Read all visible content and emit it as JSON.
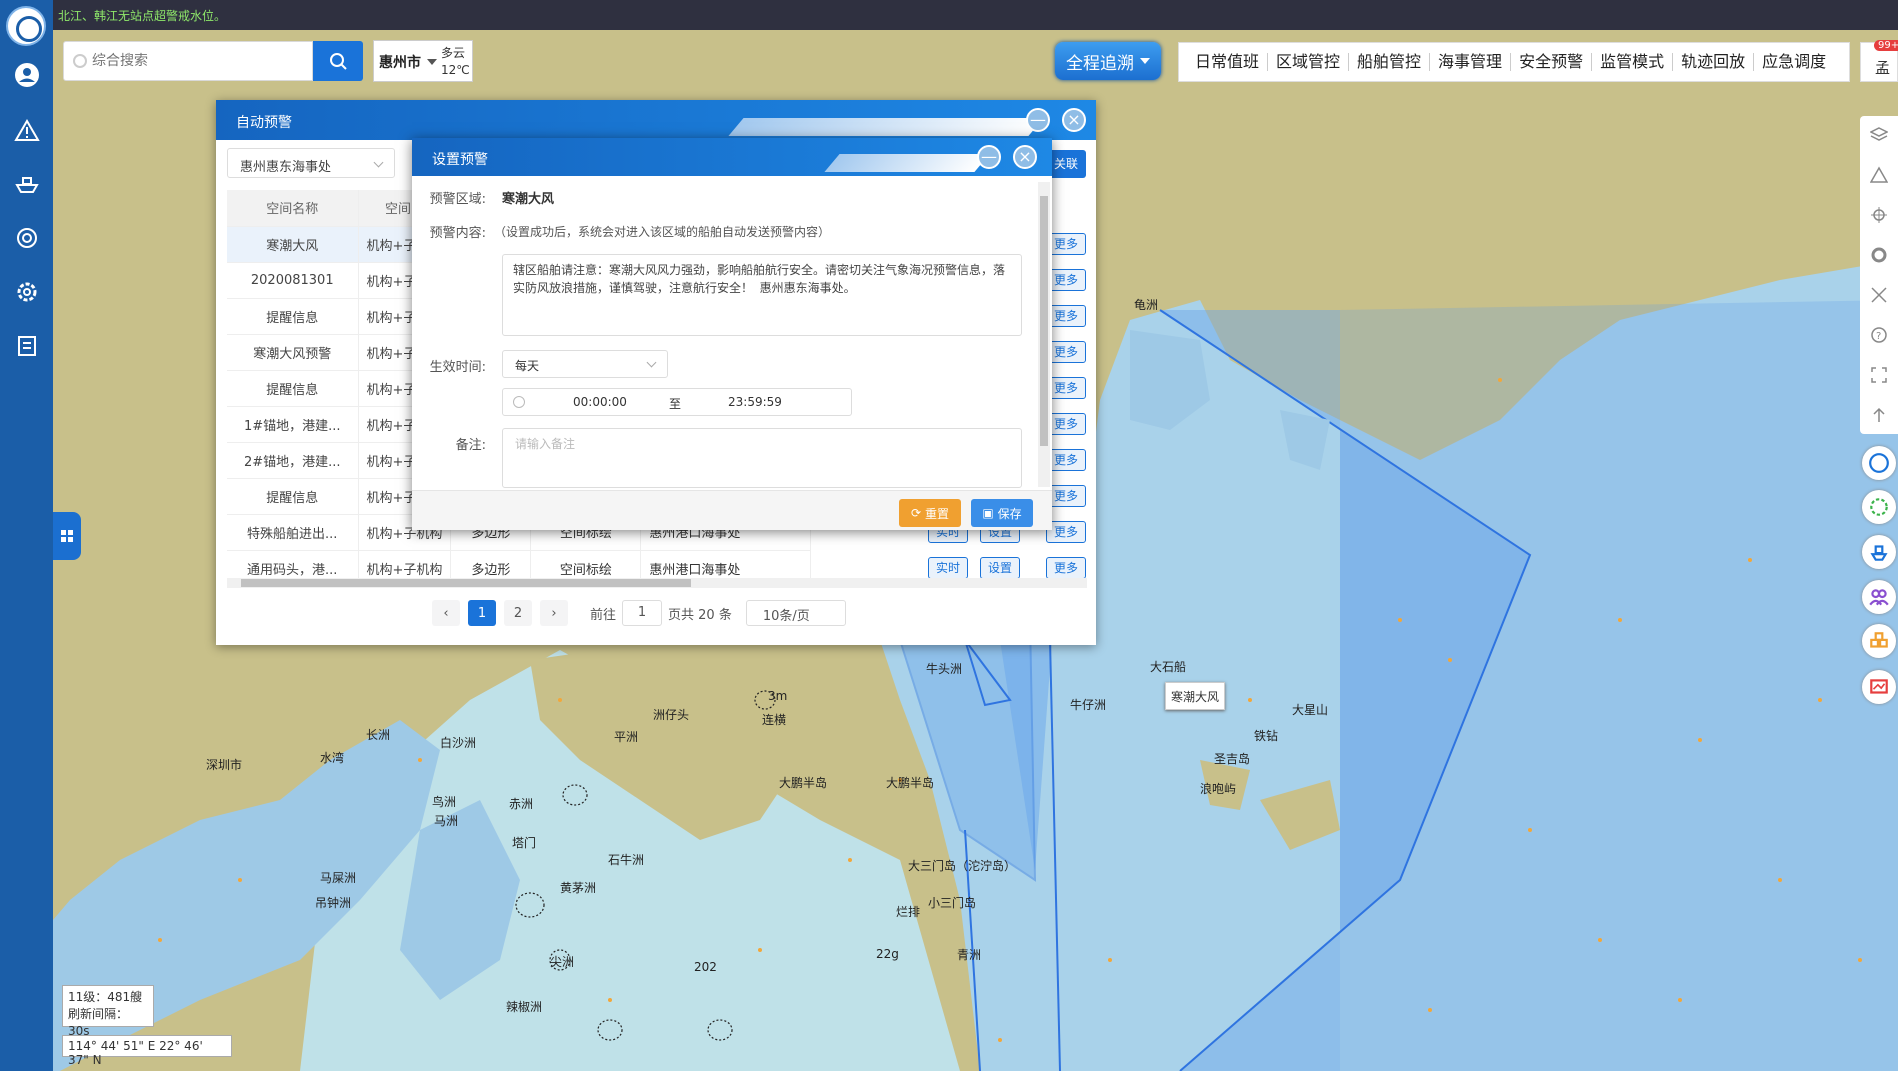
{
  "notice": "北江、韩江无站点超警戒水位。",
  "search": {
    "placeholder": "综合搜索"
  },
  "city": {
    "name": "惠州市",
    "weather": "多云",
    "temp": "12℃"
  },
  "track_button": "全程追溯",
  "top_menu": [
    "日常值班",
    "区域管控",
    "船舶管控",
    "海事管理",
    "安全预警",
    "监管模式",
    "轨迹回放",
    "应急调度"
  ],
  "top_right": {
    "badge": "99+",
    "label": "孟"
  },
  "sidebar_icons": [
    "user-icon",
    "alert-icon",
    "ship-icon",
    "lifebuoy-icon",
    "settings-icon",
    "clipboard-icon"
  ],
  "dialog_auto": {
    "title": "自动预警",
    "org_select": "惠州惠东海事处",
    "relate_button": "关联",
    "columns": [
      "空间名称",
      "空间归"
    ],
    "rows": [
      {
        "name": "寒潮大风",
        "type": "机构+子"
      },
      {
        "name": "2020081301",
        "type": "机构+子"
      },
      {
        "name": "提醒信息",
        "type": "机构+子"
      },
      {
        "name": "寒潮大风预警",
        "type": "机构+子"
      },
      {
        "name": "提醒信息",
        "type": "机构+子"
      },
      {
        "name": "1#锚地，港建...",
        "type": "机构+子"
      },
      {
        "name": "2#锚地，港建...",
        "type": "机构+子"
      },
      {
        "name": "提醒信息",
        "type": "机构+子"
      },
      {
        "name": "特殊船舶进出...",
        "type": "机构+子机构",
        "shape": "多边形",
        "kind": "空间标绘",
        "org": "惠州港口海事处"
      },
      {
        "name": "通用码头，港...",
        "type": "机构+子机构",
        "shape": "多边形",
        "kind": "空间标绘",
        "org": "惠州港口海事处"
      }
    ],
    "op_realtime": "实时",
    "op_settings": "设置",
    "op_more": "更多",
    "pager": {
      "pages": [
        "1",
        "2"
      ],
      "goto_label": "前往",
      "goto_value": "1",
      "total": "页共 20 条",
      "page_size": "10条/页"
    }
  },
  "dialog_set": {
    "title": "设置预警",
    "area_label": "预警区域:",
    "area_value": "寒潮大风",
    "content_label": "预警内容:",
    "content_hint": "（设置成功后，系统会对进入该区域的船舶自动发送预警内容）",
    "content_text": "辖区船舶请注意：寒潮大风风力强劲，影响船舶航行安全。请密切关注气象海况预警信息，落实防风放浪措施，谨慎驾驶，注意航行安全！  惠州惠东海事处。",
    "effective_label": "生效时间:",
    "effective_value": "每天",
    "time_start": "00:00:00",
    "time_sep": "至",
    "time_end": "23:59:59",
    "remark_label": "备注:",
    "remark_placeholder": "请输入备注",
    "reset_button": "重置",
    "save_button": "保存"
  },
  "map": {
    "labels": [
      "深圳市",
      "水湾",
      "长洲",
      "白沙洲",
      "平洲",
      "洲仔头",
      "连横",
      "大鹏半岛",
      "大鹏半岛",
      "赤洲",
      "鸟洲",
      "马洲",
      "塔门",
      "石牛洲",
      "黄茅洲",
      "马屎洲",
      "吊钟洲",
      "尖洲",
      "辣椒洲",
      "龟洲",
      "牛头洲",
      "牛仔洲",
      "大石船",
      "大星山",
      "铁钻",
      "圣吉岛",
      "浪咆屿",
      "大三门岛（沱泞岛）",
      "小三门岛",
      "烂排",
      "青洲",
      "3m",
      "202",
      "22g"
    ],
    "area_tag": "寒潮大风",
    "info_level": "11级：481艘",
    "info_refresh": "刷新间隔：30s",
    "coords": "114° 44' 51\" E   22° 46' 37\" N"
  },
  "colors": {
    "primary": "#1a73d9",
    "sidebar": "#1b5ea8",
    "reset": "#f0a030",
    "save": "#3a8ee8",
    "land": "#c8c08a",
    "sea": "#9ec9e6",
    "zone": "#6aa6ec"
  }
}
